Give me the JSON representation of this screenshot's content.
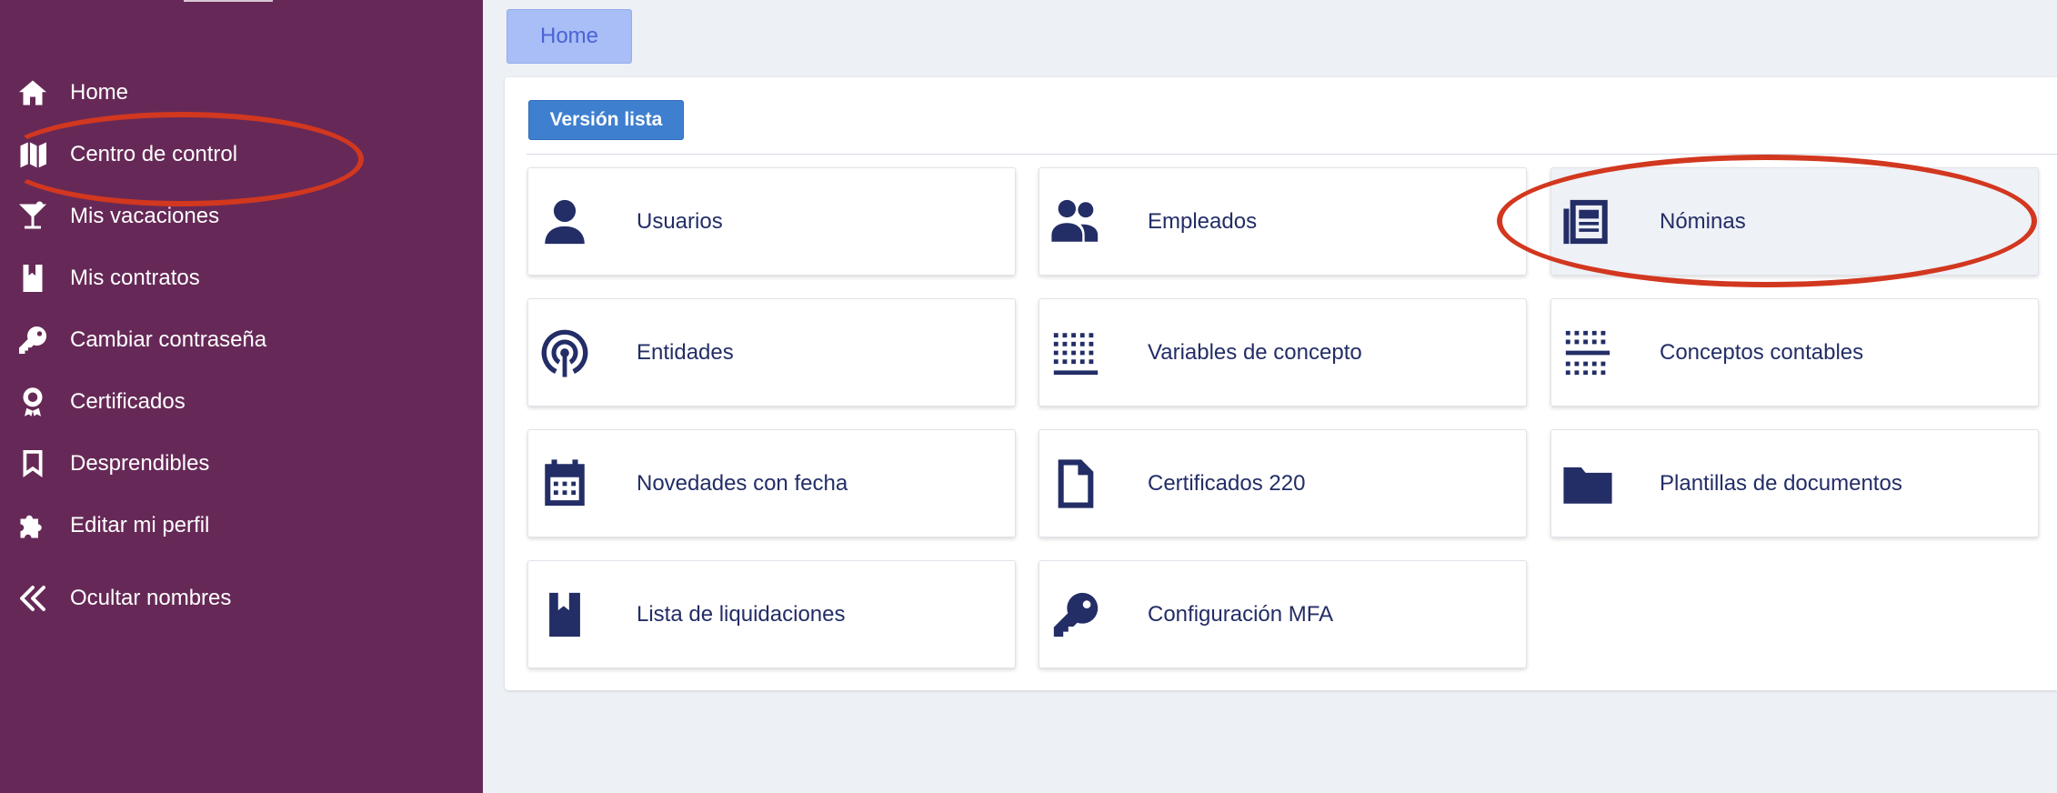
{
  "sidebar": {
    "items": [
      {
        "label": "Home",
        "icon": "home-icon"
      },
      {
        "label": "Centro de control",
        "icon": "map-icon"
      },
      {
        "label": "Mis vacaciones",
        "icon": "cocktail-icon"
      },
      {
        "label": "Mis contratos",
        "icon": "book-icon"
      },
      {
        "label": "Cambiar contraseña",
        "icon": "key-icon"
      },
      {
        "label": "Certificados",
        "icon": "award-icon"
      },
      {
        "label": "Desprendibles",
        "icon": "bookmark-icon"
      },
      {
        "label": "Editar mi perfil",
        "icon": "puzzle-icon"
      },
      {
        "label": "Ocultar nombres",
        "icon": "double-chevron-left-icon"
      }
    ]
  },
  "breadcrumb": {
    "label": "Home"
  },
  "toolbar": {
    "version_label": "Versión lista"
  },
  "tiles": [
    {
      "label": "Usuarios",
      "icon": "user-icon"
    },
    {
      "label": "Empleados",
      "icon": "users-icon"
    },
    {
      "label": "Nóminas",
      "icon": "newspaper-icon"
    },
    {
      "label": "Entidades",
      "icon": "broadcast-icon"
    },
    {
      "label": "Variables de concepto",
      "icon": "dotted-grid-icon"
    },
    {
      "label": "Conceptos contables",
      "icon": "dotted-lines-icon"
    },
    {
      "label": "Novedades con fecha",
      "icon": "calendar-icon"
    },
    {
      "label": "Certificados 220",
      "icon": "file-icon"
    },
    {
      "label": "Plantillas de documentos",
      "icon": "folder-icon"
    },
    {
      "label": "Lista de liquidaciones",
      "icon": "book-icon"
    },
    {
      "label": "Configuración MFA",
      "icon": "key-icon"
    }
  ],
  "colors": {
    "sidebar_bg": "#662957",
    "accent_blue": "#3f7fd0",
    "tile_text": "#232d66",
    "annotation_red": "#d2371f"
  }
}
